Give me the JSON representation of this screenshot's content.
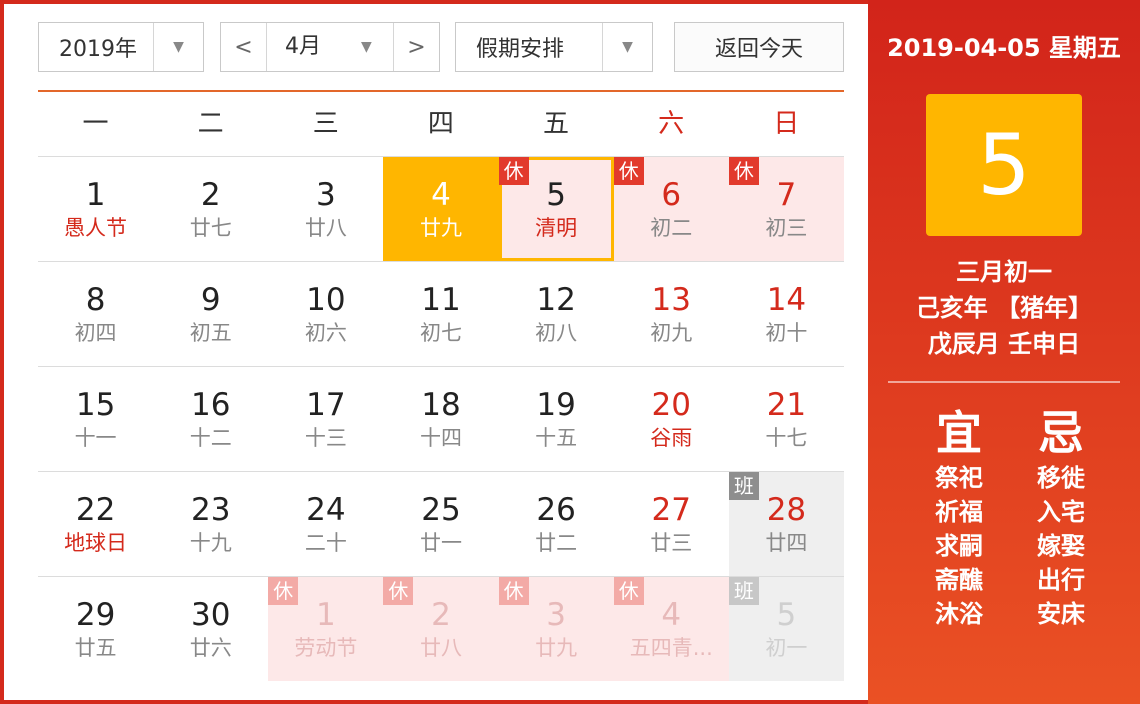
{
  "toolbar": {
    "year": "2019年",
    "month": "4月",
    "prev": "<",
    "next": ">",
    "holiday": "假期安排",
    "today": "返回今天",
    "dropdown_glyph": "▼"
  },
  "weekdays": [
    "一",
    "二",
    "三",
    "四",
    "五",
    "六",
    "日"
  ],
  "weeks": [
    [
      {
        "day": "1",
        "lunar": "愚人节",
        "festival": true
      },
      {
        "day": "2",
        "lunar": "廿七"
      },
      {
        "day": "3",
        "lunar": "廿八"
      },
      {
        "day": "4",
        "lunar": "廿九",
        "today": true
      },
      {
        "day": "5",
        "lunar": "清明",
        "festival": true,
        "badge": "休",
        "selected": true
      },
      {
        "day": "6",
        "lunar": "初二",
        "badge": "休",
        "weekend": true
      },
      {
        "day": "7",
        "lunar": "初三",
        "badge": "休",
        "weekend": true
      }
    ],
    [
      {
        "day": "8",
        "lunar": "初四"
      },
      {
        "day": "9",
        "lunar": "初五"
      },
      {
        "day": "10",
        "lunar": "初六"
      },
      {
        "day": "11",
        "lunar": "初七"
      },
      {
        "day": "12",
        "lunar": "初八"
      },
      {
        "day": "13",
        "lunar": "初九",
        "weekend": true
      },
      {
        "day": "14",
        "lunar": "初十",
        "weekend": true
      }
    ],
    [
      {
        "day": "15",
        "lunar": "十一"
      },
      {
        "day": "16",
        "lunar": "十二"
      },
      {
        "day": "17",
        "lunar": "十三"
      },
      {
        "day": "18",
        "lunar": "十四"
      },
      {
        "day": "19",
        "lunar": "十五"
      },
      {
        "day": "20",
        "lunar": "谷雨",
        "weekend": true,
        "festival": true
      },
      {
        "day": "21",
        "lunar": "十七",
        "weekend": true
      }
    ],
    [
      {
        "day": "22",
        "lunar": "地球日",
        "festival": true
      },
      {
        "day": "23",
        "lunar": "十九"
      },
      {
        "day": "24",
        "lunar": "二十"
      },
      {
        "day": "25",
        "lunar": "廿一"
      },
      {
        "day": "26",
        "lunar": "廿二"
      },
      {
        "day": "27",
        "lunar": "廿三",
        "weekend": true
      },
      {
        "day": "28",
        "lunar": "廿四",
        "weekend": true,
        "badge": "班"
      }
    ],
    [
      {
        "day": "29",
        "lunar": "廿五"
      },
      {
        "day": "30",
        "lunar": "廿六"
      },
      {
        "day": "1",
        "lunar": "劳动节",
        "other": true,
        "badge": "休"
      },
      {
        "day": "2",
        "lunar": "廿八",
        "other": true,
        "badge": "休"
      },
      {
        "day": "3",
        "lunar": "廿九",
        "other": true,
        "badge": "休"
      },
      {
        "day": "4",
        "lunar": "五四青...",
        "other": true,
        "badge": "休"
      },
      {
        "day": "5",
        "lunar": "初一",
        "other": true,
        "badge": "班"
      }
    ]
  ],
  "panel": {
    "date": "2019-04-05 星期五",
    "big_day": "5",
    "lunar_date": "三月初一",
    "year_ganzhi": "己亥年 【猪年】",
    "month_day_ganzhi": "戊辰月 壬申日",
    "yi_title": "宜",
    "ji_title": "忌",
    "yi": [
      "祭祀",
      "祈福",
      "求嗣",
      "斋醮",
      "沐浴"
    ],
    "ji": [
      "移徙",
      "入宅",
      "嫁娶",
      "出行",
      "安床"
    ]
  },
  "colors": {
    "accent_red": "#d42a1c",
    "today_orange": "#ffb600",
    "rest_bg": "#fde8e8",
    "work_bg": "#efefef"
  }
}
